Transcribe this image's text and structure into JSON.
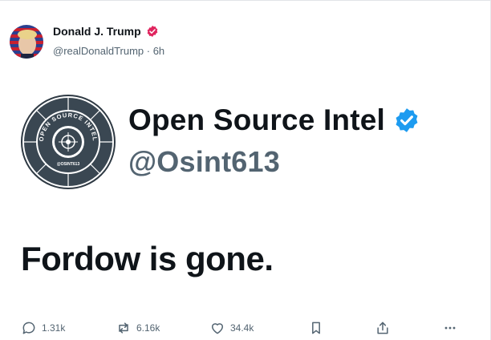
{
  "author": {
    "name": "Donald J. Trump",
    "handle_time": "@realDonaldTrump · 6h",
    "verified_color": "#e0245e"
  },
  "embedded_account": {
    "name": "Open Source Intel",
    "handle": "@Osint613",
    "verified_color": "#1d9bf0",
    "logo_text": "OPEN SOURCE INTEL",
    "logo_subtext": "@OSINT613"
  },
  "post": {
    "text": "Fordow is gone."
  },
  "actions": {
    "replies": "1.31k",
    "reposts": "6.16k",
    "likes": "34.4k"
  }
}
